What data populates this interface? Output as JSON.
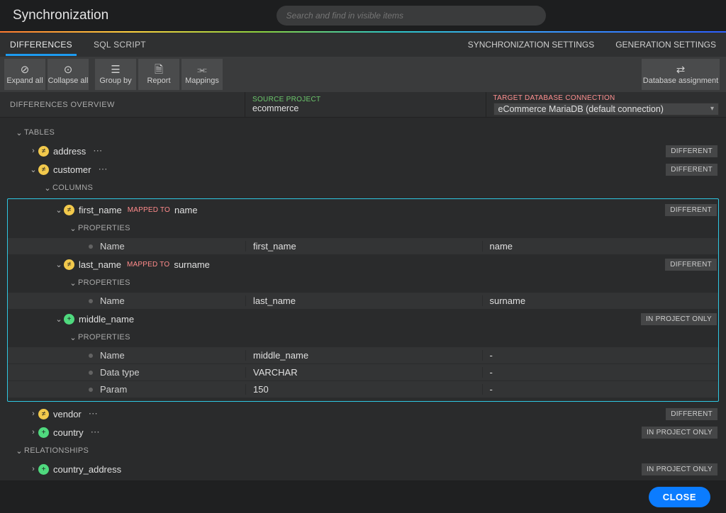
{
  "header": {
    "title": "Synchronization"
  },
  "search": {
    "placeholder": "Search and find in visible items"
  },
  "tabs": {
    "differences": "DIFFERENCES",
    "sql_script": "SQL SCRIPT",
    "sync_settings": "SYNCHRONIZATION SETTINGS",
    "gen_settings": "GENERATION SETTINGS"
  },
  "toolbar": {
    "expand_all": "Expand all",
    "collapse_all": "Collapse all",
    "group_by": "Group by",
    "report": "Report",
    "mappings": "Mappings",
    "db_assignment": "Database assignment"
  },
  "overview_label": "DIFFERENCES OVERVIEW",
  "source": {
    "label": "SOURCE PROJECT",
    "value": "ecommerce"
  },
  "target": {
    "label": "TARGET DATABASE CONNECTION",
    "value": "eCommerce MariaDB (default connection)"
  },
  "badges": {
    "different": "DIFFERENT",
    "in_project_only": "IN PROJECT ONLY"
  },
  "sections": {
    "tables": "TABLES",
    "columns": "COLUMNS",
    "properties": "PROPERTIES",
    "relationships": "RELATIONSHIPS"
  },
  "mapped_to": "MAPPED TO",
  "items": {
    "address": "address",
    "customer": "customer",
    "vendor": "vendor",
    "country": "country",
    "country_address": "country_address"
  },
  "cols": {
    "first_name": {
      "name": "first_name",
      "target": "name"
    },
    "last_name": {
      "name": "last_name",
      "target": "surname"
    },
    "middle_name": {
      "name": "middle_name"
    }
  },
  "propnames": {
    "name": "Name",
    "datatype": "Data type",
    "param": "Param"
  },
  "propvals": {
    "first_name_src": "first_name",
    "first_name_tgt": "name",
    "last_name_src": "last_name",
    "last_name_tgt": "surname",
    "middle_name_src": "middle_name",
    "middle_datatype": "VARCHAR",
    "middle_param": "150",
    "dash": "-"
  },
  "footer": {
    "close": "CLOSE"
  }
}
